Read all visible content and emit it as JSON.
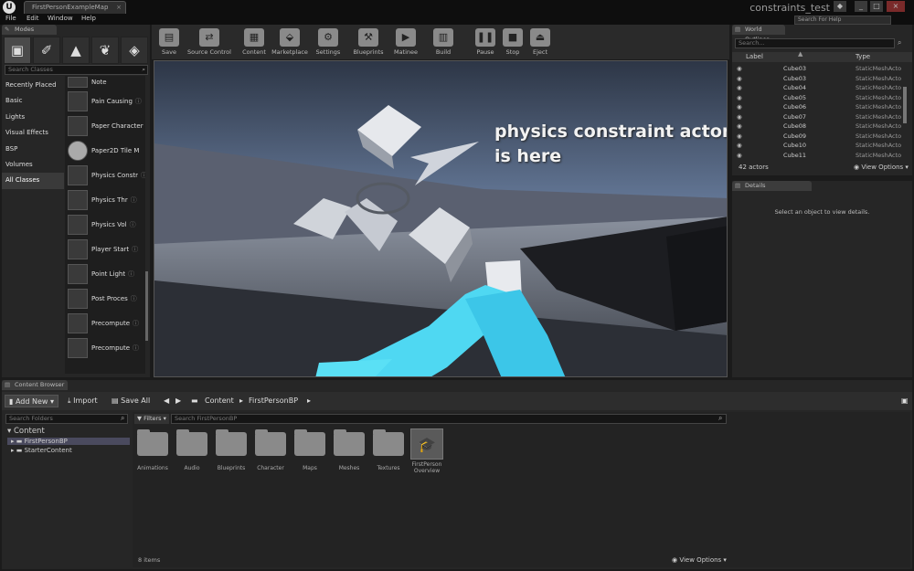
{
  "title_bar": {
    "tab_title": "FirstPersonExampleMap",
    "project_name": "constraints_test",
    "help_search_placeholder": "Search For Help"
  },
  "menu": [
    "File",
    "Edit",
    "Window",
    "Help"
  ],
  "modes_panel": {
    "tab_label": "Modes",
    "search_placeholder": "Search Classes",
    "categories": [
      "Recently Placed",
      "Basic",
      "Lights",
      "Visual Effects",
      "BSP",
      "Volumes",
      "All Classes"
    ],
    "selected_category": "All Classes",
    "items": [
      "Note",
      "Pain Causing",
      "Paper Character",
      "Paper2D Tile M",
      "Physics Constr",
      "Physics Thr",
      "Physics Vol",
      "Player Start",
      "Point Light",
      "Post Proces",
      "Precompute",
      "Precompute"
    ]
  },
  "toolbar": [
    "Save",
    "Source Control",
    "Content",
    "Marketplace",
    "Settings",
    "Blueprints",
    "Matinee",
    "Build",
    "Pause",
    "Stop",
    "Eject"
  ],
  "viewport": {
    "annotation_line1": "physics constraint actor",
    "annotation_line2": "is here"
  },
  "world_outliner": {
    "tab_label": "World Outliner",
    "search_placeholder": "Search...",
    "col_label": "Label",
    "col_type": "Type",
    "rows": [
      {
        "name": "Cube03",
        "type": "StaticMeshActo"
      },
      {
        "name": "Cube03",
        "type": "StaticMeshActo"
      },
      {
        "name": "Cube04",
        "type": "StaticMeshActo"
      },
      {
        "name": "Cube05",
        "type": "StaticMeshActo"
      },
      {
        "name": "Cube06",
        "type": "StaticMeshActo"
      },
      {
        "name": "Cube07",
        "type": "StaticMeshActo"
      },
      {
        "name": "Cube08",
        "type": "StaticMeshActo"
      },
      {
        "name": "Cube09",
        "type": "StaticMeshActo"
      },
      {
        "name": "Cube10",
        "type": "StaticMeshActo"
      },
      {
        "name": "Cube11",
        "type": "StaticMeshActo"
      }
    ],
    "actor_count": "42 actors",
    "view_options": "View Options"
  },
  "details": {
    "tab_label": "Details",
    "empty_message": "Select an object to view details."
  },
  "content_browser": {
    "tab_label": "Content Browser",
    "add_new": "Add New",
    "import": "Import",
    "save_all": "Save All",
    "path": [
      "Content",
      "FirstPersonBP"
    ],
    "folder_search_placeholder": "Search Folders",
    "tree_root": "Content",
    "tree_items": [
      "FirstPersonBP",
      "StarterContent"
    ],
    "filters_label": "Filters",
    "asset_search_placeholder": "Search FirstPersonBP",
    "assets": [
      "Animations",
      "Audio",
      "Blueprints",
      "Character",
      "Maps",
      "Meshes",
      "Textures"
    ],
    "overview_asset": "FirstPerson Overview",
    "item_count": "8 items",
    "view_options": "View Options"
  }
}
